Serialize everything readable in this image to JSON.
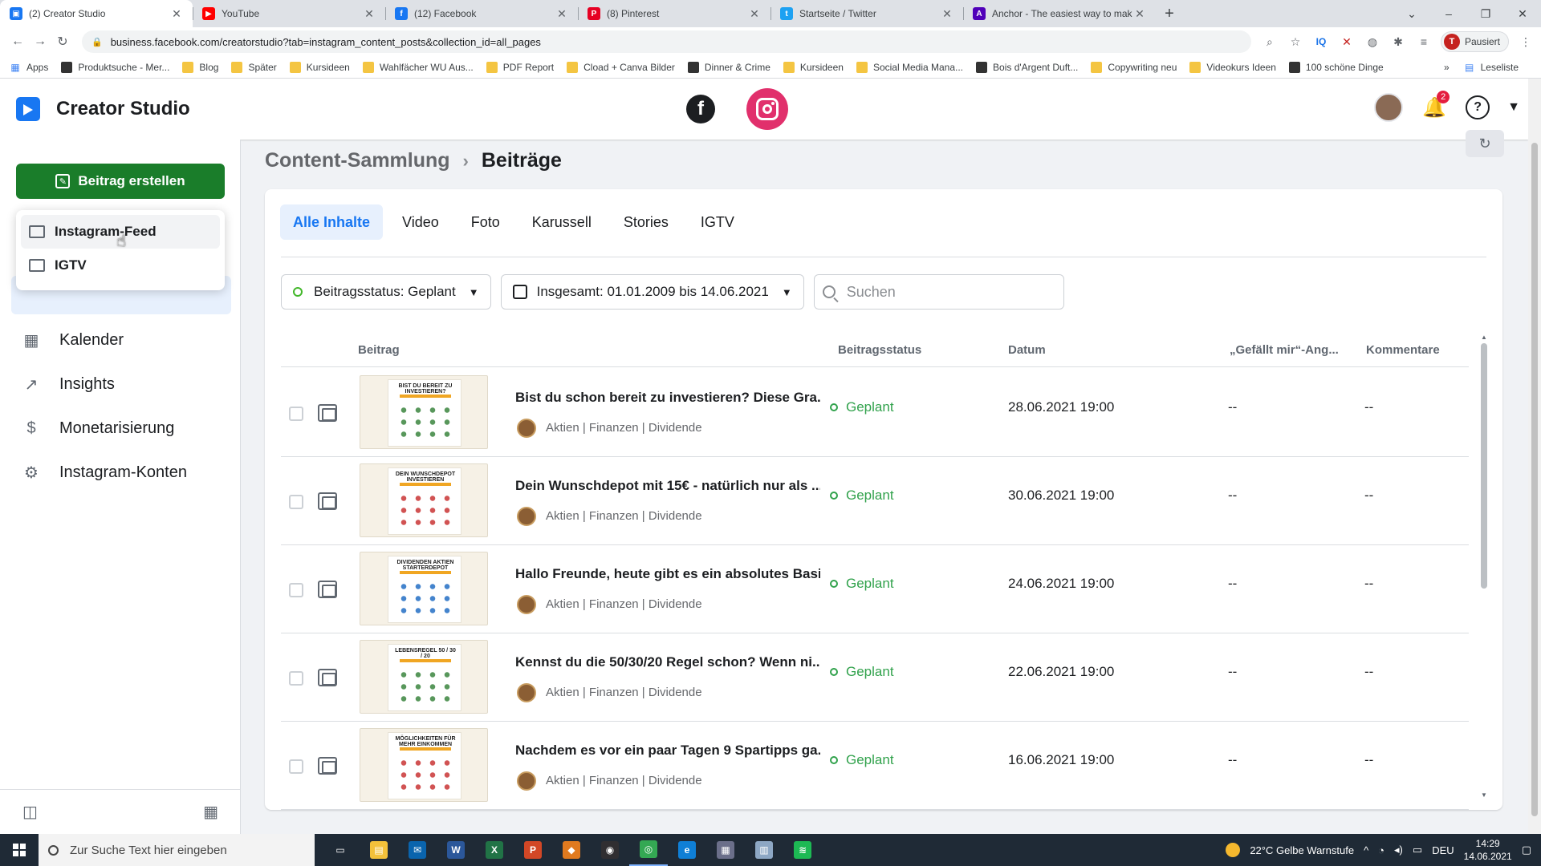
{
  "browser": {
    "tabs": [
      {
        "title": "(2) Creator Studio",
        "color": "#1877f2",
        "glyph": "▣",
        "active": true
      },
      {
        "title": "YouTube",
        "color": "#ff0000",
        "glyph": "▶",
        "active": false
      },
      {
        "title": "(12) Facebook",
        "color": "#1877f2",
        "glyph": "f",
        "active": false
      },
      {
        "title": "(8) Pinterest",
        "color": "#e60023",
        "glyph": "P",
        "active": false
      },
      {
        "title": "Startseite / Twitter",
        "color": "#1da1f2",
        "glyph": "t",
        "active": false
      },
      {
        "title": "Anchor - The easiest way to mak",
        "color": "#5000b9",
        "glyph": "A",
        "active": false
      }
    ],
    "url": "business.facebook.com/creatorstudio?tab=instagram_content_posts&collection_id=all_pages",
    "profile_initial": "T",
    "profile_label": "Pausiert",
    "bookmarks": [
      {
        "label": "Apps",
        "kind": "grid"
      },
      {
        "label": "Produktsuche - Mer...",
        "kind": "site"
      },
      {
        "label": "Blog",
        "kind": "folder"
      },
      {
        "label": "Später",
        "kind": "folder"
      },
      {
        "label": "Kursideen",
        "kind": "folder"
      },
      {
        "label": "Wahlfächer WU Aus...",
        "kind": "folder"
      },
      {
        "label": "PDF Report",
        "kind": "folder"
      },
      {
        "label": "Cload + Canva Bilder",
        "kind": "folder"
      },
      {
        "label": "Dinner & Crime",
        "kind": "site"
      },
      {
        "label": "Kursideen",
        "kind": "folder"
      },
      {
        "label": "Social Media Mana...",
        "kind": "folder"
      },
      {
        "label": "Bois d'Argent Duft...",
        "kind": "site"
      },
      {
        "label": "Copywriting neu",
        "kind": "folder"
      },
      {
        "label": "Videokurs Ideen",
        "kind": "folder"
      },
      {
        "label": "100 schöne Dinge",
        "kind": "site"
      }
    ],
    "more_bookmarks": "»",
    "reading_list": "Leseliste"
  },
  "header": {
    "title": "Creator Studio",
    "notification_count": "2"
  },
  "sidebar": {
    "create_label": "Beitrag erstellen",
    "dropdown": [
      {
        "label": "Instagram-Feed"
      },
      {
        "label": "IGTV"
      }
    ],
    "nav": [
      {
        "label": "Kalender",
        "icon": "▦"
      },
      {
        "label": "Insights",
        "icon": "↗"
      },
      {
        "label": "Monetarisierung",
        "icon": "$"
      },
      {
        "label": "Instagram-Konten",
        "icon": "⚙"
      }
    ]
  },
  "main": {
    "breadcrumb_parent": "Content-Sammlung",
    "breadcrumb_current": "Beiträge",
    "tabs": [
      "Alle Inhalte",
      "Video",
      "Foto",
      "Karussell",
      "Stories",
      "IGTV"
    ],
    "filter_status": "Beitragsstatus: Geplant",
    "filter_date": "Insgesamt: 01.01.2009 bis 14.06.2021",
    "search_placeholder": "Suchen",
    "columns": {
      "post": "Beitrag",
      "status": "Beitragsstatus",
      "date": "Datum",
      "likes": "„Gefällt mir“-Ang...",
      "comments": "Kommentare"
    },
    "rows": [
      {
        "thumb_title": "BIST DU BEREIT ZU INVESTIEREN?",
        "caption": "Bist du schon bereit zu investieren? Diese Gra...",
        "tags": "Aktien | Finanzen | Dividende",
        "status": "Geplant",
        "date": "28.06.2021 19:00",
        "likes": "--",
        "comments": "--"
      },
      {
        "thumb_title": "DEIN WUNSCHDEPOT INVESTIEREN",
        "caption": "Dein Wunschdepot mit 15€ - natürlich nur als ...",
        "tags": "Aktien | Finanzen | Dividende",
        "status": "Geplant",
        "date": "30.06.2021 19:00",
        "likes": "--",
        "comments": "--"
      },
      {
        "thumb_title": "DIVIDENDEN AKTIEN STARTERDEPOT",
        "caption": "Hallo Freunde, heute gibt es ein absolutes Basi...",
        "tags": "Aktien | Finanzen | Dividende",
        "status": "Geplant",
        "date": "24.06.2021 19:00",
        "likes": "--",
        "comments": "--"
      },
      {
        "thumb_title": "LEBENSREGEL 50 / 30 / 20",
        "caption": "Kennst du die 50/30/20 Regel schon? Wenn ni...",
        "tags": "Aktien | Finanzen | Dividende",
        "status": "Geplant",
        "date": "22.06.2021 19:00",
        "likes": "--",
        "comments": "--"
      },
      {
        "thumb_title": "MÖGLICHKEITEN FÜR MEHR EINKOMMEN",
        "caption": "Nachdem es vor ein paar Tagen 9 Spartipps ga...",
        "tags": "Aktien | Finanzen | Dividende",
        "status": "Geplant",
        "date": "16.06.2021 19:00",
        "likes": "--",
        "comments": "--"
      }
    ]
  },
  "taskbar": {
    "search_placeholder": "Zur Suche Text hier eingeben",
    "apps": [
      {
        "name": "task-view",
        "glyph": "▭",
        "color": "transparent"
      },
      {
        "name": "file-explorer",
        "glyph": "▤",
        "color": "#f3c13a"
      },
      {
        "name": "mail",
        "glyph": "✉",
        "color": "#0a64ad"
      },
      {
        "name": "word",
        "glyph": "W",
        "color": "#2b579a"
      },
      {
        "name": "excel",
        "glyph": "X",
        "color": "#217346"
      },
      {
        "name": "powerpoint",
        "glyph": "P",
        "color": "#d24726"
      },
      {
        "name": "app-orange",
        "glyph": "◆",
        "color": "#e07a1f"
      },
      {
        "name": "obs",
        "glyph": "◉",
        "color": "#302e31"
      },
      {
        "name": "chrome",
        "glyph": "◎",
        "color": "#34a853"
      },
      {
        "name": "edge",
        "glyph": "e",
        "color": "#0f7fd6"
      },
      {
        "name": "app-doc",
        "glyph": "▦",
        "color": "#6b6f8a"
      },
      {
        "name": "notepad",
        "glyph": "▥",
        "color": "#8da7c4"
      },
      {
        "name": "spotify",
        "glyph": "≋",
        "color": "#1db954"
      }
    ],
    "weather": "22°C  Gelbe Warnstufe",
    "language": "DEU",
    "time": "14:29",
    "date": "14.06.2021"
  }
}
